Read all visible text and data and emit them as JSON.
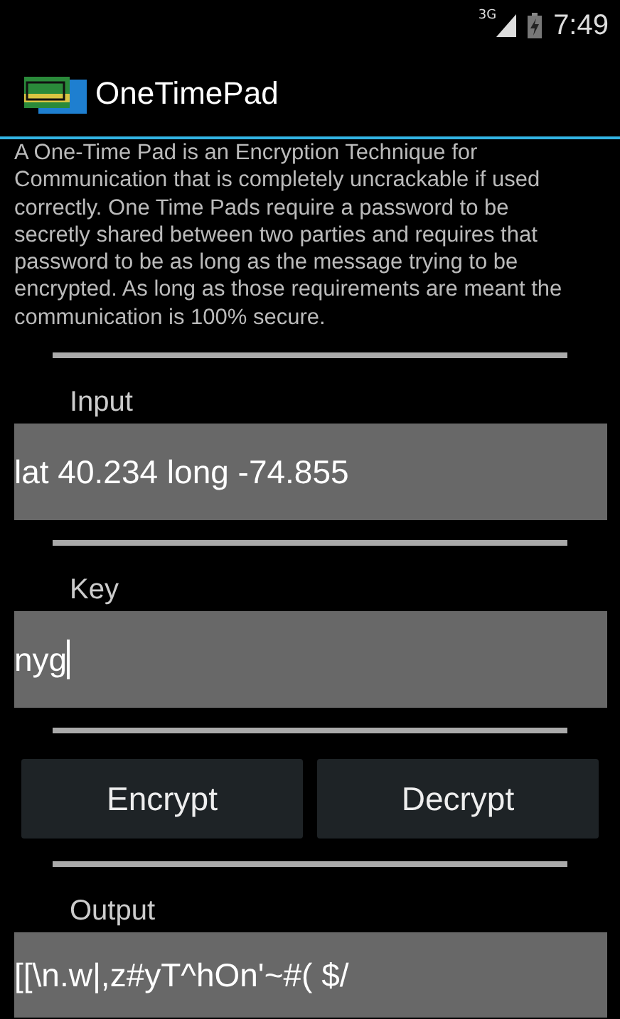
{
  "status_bar": {
    "network": "3G",
    "time": "7:49"
  },
  "action_bar": {
    "title": "OneTimePad"
  },
  "description": "A One-Time Pad is an Encryption Technique for Communication that is completely uncrackable if used correctly. One Time Pads require a password to be secretly shared between two parties and requires that password to be as long as the message trying to be encrypted. As long as those requirements are meant the communication is 100% secure.",
  "input": {
    "label": "Input",
    "value": "lat 40.234 long -74.855",
    "focused": false
  },
  "key": {
    "label": "Key",
    "value": "nyg",
    "focused": true
  },
  "buttons": [
    "Encrypt",
    "Decrypt"
  ],
  "output": {
    "label": "Output",
    "value": "[[\\n.w|,z#yT^hOn'~#( $/",
    "focused": false
  }
}
